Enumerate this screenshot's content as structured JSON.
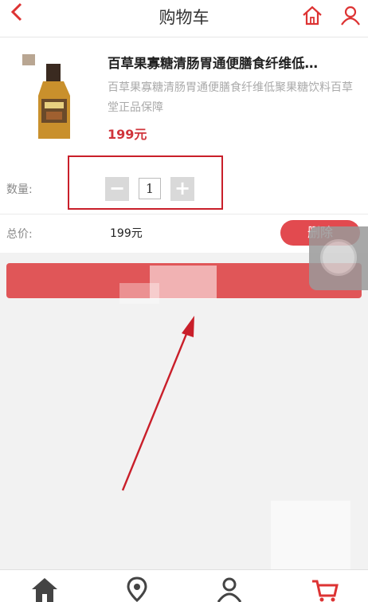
{
  "header": {
    "title": "购物车",
    "back_icon": "chevron-left-icon",
    "home_icon": "home-icon",
    "user_icon": "user-icon"
  },
  "product": {
    "name": "百草果寡糖清肠胃通便膳食纤维低…",
    "description": "百草果寡糖清肠胃通便膳食纤维低聚果糖饮料百草堂正品保障",
    "price": "199元"
  },
  "quantity": {
    "label": "数量:",
    "value": "1",
    "minus": "−",
    "plus": "+"
  },
  "total": {
    "label": "总价:",
    "value": "199元"
  },
  "actions": {
    "delete_label": "删除"
  },
  "tabbar": {
    "icons": [
      "home-icon",
      "location-pin-icon",
      "user-icon",
      "cart-icon"
    ]
  },
  "colors": {
    "accent": "#d0343b",
    "button": "#e05658",
    "delete": "#e24a4f",
    "annotation": "#c91f2a"
  }
}
